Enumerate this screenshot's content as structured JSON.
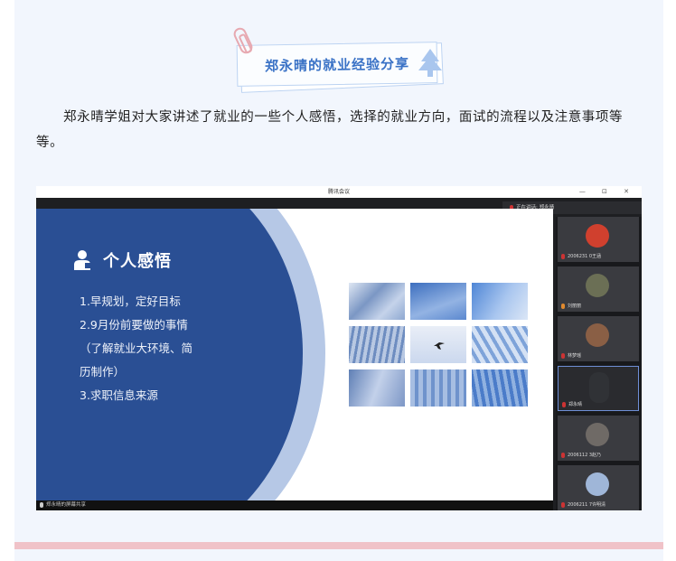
{
  "header": {
    "badge_title": "郑永晴的就业经验分享"
  },
  "article": {
    "paragraph": "郑永晴学姐对大家讲述了就业的一些个人感悟，选择的就业方向，面试的流程以及注意事项等等。"
  },
  "meeting": {
    "window_title": "腾讯会议",
    "window_controls": "— ⊡ ✕",
    "speaking_label": "正在讲话: 郑永晴",
    "status_bar": "郑永晴的屏幕共享",
    "slide": {
      "title": "个人感悟",
      "lines": [
        "1.早规划，定好目标",
        "2.9月份前要做的事情",
        "（了解就业大环境、简",
        "历制作）",
        "3.求职信息来源"
      ]
    },
    "participants": [
      {
        "name": "2006231 0王涵",
        "avatar_color": "#d0402e"
      },
      {
        "name": "刘丽丽",
        "avatar_color": "#6b6f55"
      },
      {
        "name": "林梦瑶",
        "avatar_color": "#8a5f45"
      },
      {
        "name": "郑永晴",
        "avatar_color": "#303236"
      },
      {
        "name": "2006112 3赵乃",
        "avatar_color": "#6f6a66"
      },
      {
        "name": "2006211 7许明清",
        "avatar_color": "#9fb6d8"
      }
    ]
  },
  "colors": {
    "panel_bg": "#f2f6fd",
    "accent_blue": "#3a72c6",
    "divider_pink": "#f0c2c8",
    "slide_blue": "#2a4f94"
  }
}
